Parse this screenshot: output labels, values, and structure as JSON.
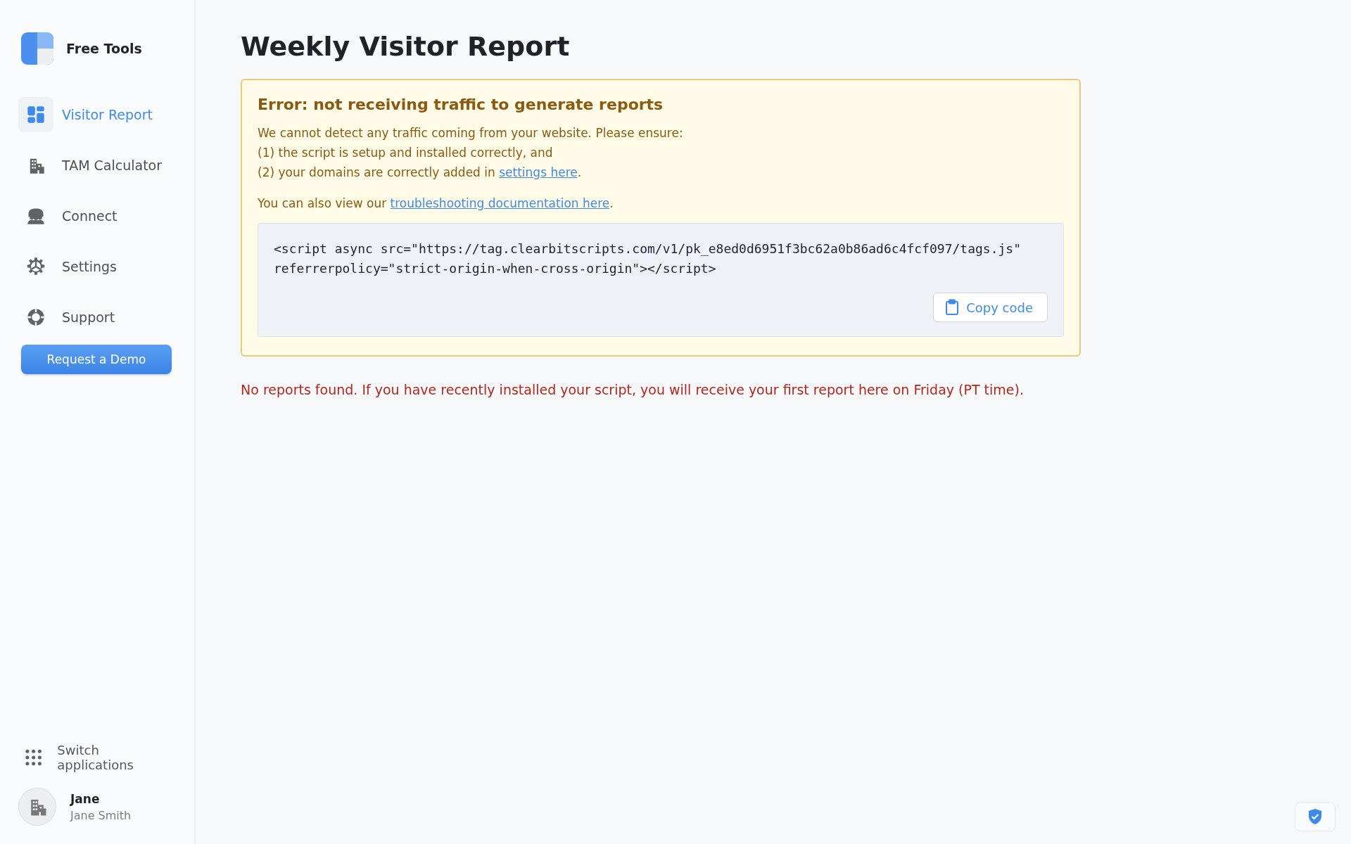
{
  "sidebar": {
    "brand": "Free Tools",
    "items": [
      {
        "label": "Visitor Report",
        "selected": true
      },
      {
        "label": "TAM Calculator",
        "selected": false
      },
      {
        "label": "Connect",
        "selected": false
      },
      {
        "label": "Settings",
        "selected": false
      },
      {
        "label": "Support",
        "selected": false
      }
    ],
    "demo_button": "Request a Demo",
    "switch_apps": "Switch applications",
    "user": {
      "name": "Jane",
      "full_name": "Jane Smith"
    }
  },
  "page": {
    "title": "Weekly Visitor Report",
    "alert": {
      "title": "Error: not receiving traffic to generate reports",
      "lines": [
        {
          "text": "We cannot detect any traffic coming from your website. Please ensure:"
        },
        {
          "text": "(1) the script is setup and installed correctly, and"
        },
        {
          "text": "(2) your domains are correctly added in ",
          "link": "settings here",
          "after": "."
        }
      ],
      "note": {
        "text": "You can also view our ",
        "link": "troubleshooting documentation here",
        "after": "."
      },
      "code_lines": [
        "<script async src=\"https://tag.clearbitscripts.com/v1/pk_e8ed0d6951f3bc62a0b86ad6c4fcf097/tags.js\"",
        "referrerpolicy=\"strict-origin-when-cross-origin\"></script>"
      ],
      "copy_button": "Copy code"
    },
    "message": "No reports found. If you have recently installed your script, you will receive your first report here on Friday (PT time)."
  }
}
